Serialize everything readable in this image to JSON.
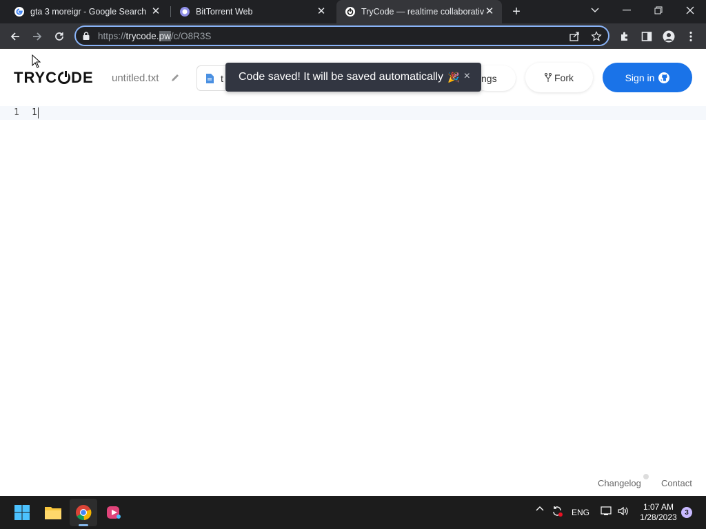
{
  "browser": {
    "tabs": [
      {
        "title": "gta 3 moreigr - Google Search",
        "favicon": "google-icon"
      },
      {
        "title": "BitTorrent Web",
        "favicon": "bittorrent-icon"
      },
      {
        "title": "TryCode — realtime collaborative",
        "favicon": "trycode-icon",
        "active": true
      }
    ],
    "url": {
      "scheme": "https://",
      "host": "trycode.",
      "selected": "pw",
      "path": "/c/O8R3S"
    }
  },
  "app": {
    "logo_before": "TRYC",
    "logo_after": "DE",
    "filename": "untitled.txt",
    "language_label": "t",
    "settings_label": "ngs",
    "fork_label": "Fork",
    "signin_label": "Sign in"
  },
  "toast": {
    "message": "Code saved! It will be saved automatically",
    "emoji": "🎉",
    "close": "×"
  },
  "editor": {
    "line_number": "1",
    "line_text": "1"
  },
  "footer": {
    "changelog": "Changelog",
    "contact": "Contact"
  },
  "taskbar": {
    "language": "ENG",
    "time": "1:07 AM",
    "date": "1/28/2023",
    "notifications": "3"
  },
  "colors": {
    "accent": "#1a73e8",
    "toast_bg": "#323641",
    "chrome_dark": "#202124"
  }
}
